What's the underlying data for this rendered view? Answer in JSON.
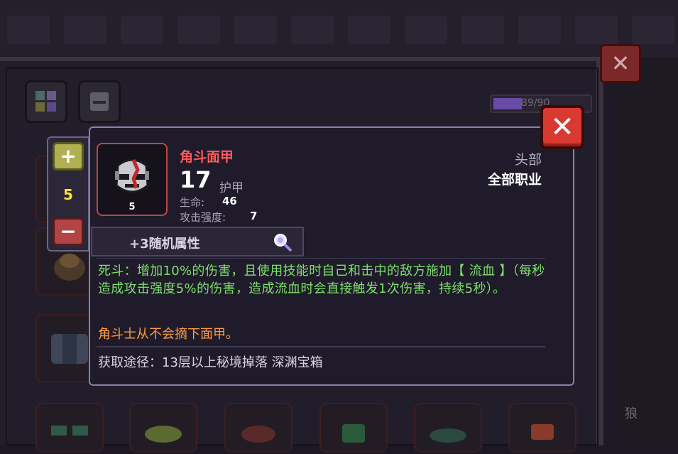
{
  "item": {
    "name": "角斗面甲",
    "level": "5",
    "armor_value": "17",
    "armor_label": "护甲",
    "stats": [
      {
        "label": "生命:",
        "value": "46"
      },
      {
        "label": "攻击强度:",
        "value": "7"
      }
    ],
    "slot": "头部",
    "class": "全部职业",
    "random_attributes": "+3随机属性",
    "effect": "死斗：增加10%的伤害，且使用技能时自己和击中的敌方施加【 流血 】（每秒造成攻击强度5%的伤害，造成流血时会直接触发1次伤害，持续5秒）。",
    "flavor": "角斗士从不会摘下面甲。",
    "source": "获取途径：13层以上秘境掉落 深渊宝箱"
  },
  "quantity": {
    "value": "5",
    "plus_label": "+",
    "minus_label": "−"
  },
  "background": {
    "counter": "89/90",
    "close_label": "✕",
    "side_text": "狼"
  },
  "close_label": "✕",
  "colors": {
    "item_name": "#ff5b5b",
    "effect": "#7de06a",
    "flavor": "#ff9a40",
    "quantity": "#ffe43a",
    "close": "#d83a32"
  },
  "icons": [
    "close-icon",
    "plus-icon",
    "minus-icon",
    "magnify-icon",
    "mask-icon"
  ]
}
